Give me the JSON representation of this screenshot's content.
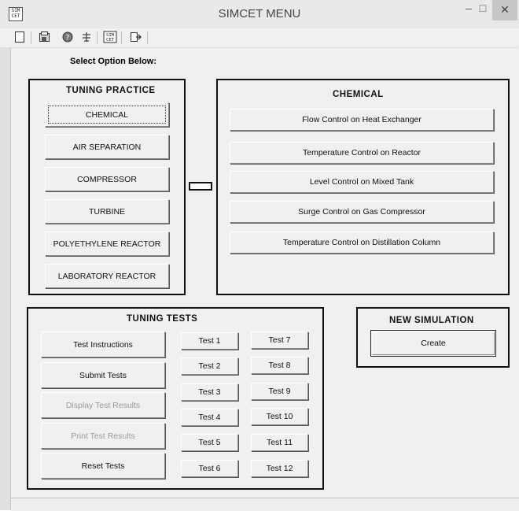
{
  "window": {
    "title": "SIMCET MENU",
    "app_icon_text": "SIM\nCET",
    "controls": {
      "minimize": "–",
      "maximize": "□",
      "close": "✕"
    }
  },
  "toolbar": {
    "icons": [
      "new-doc-icon",
      "open-folder-icon",
      "help-icon",
      "settings-icon",
      "simcet-icon",
      "exit-icon"
    ]
  },
  "main": {
    "select_label": "Select Option Below:",
    "tuning_practice": {
      "title": "TUNING PRACTICE",
      "buttons": [
        "CHEMICAL",
        "AIR SEPARATION",
        "COMPRESSOR",
        "TURBINE",
        "POLYETHYLENE REACTOR",
        "LABORATORY REACTOR"
      ]
    },
    "chemical": {
      "title": "CHEMICAL",
      "buttons": [
        "Flow Control on Heat Exchanger",
        "Temperature Control on Reactor",
        "Level Control on Mixed Tank",
        "Surge Control on Gas Compressor",
        "Temperature Control on Distillation Column"
      ]
    },
    "tuning_tests": {
      "title": "TUNING TESTS",
      "actions": [
        "Test Instructions",
        "Submit Tests",
        "Display Test Results",
        "Print Test Results",
        "Reset Tests"
      ],
      "tests_col1": [
        "Test 1",
        "Test 2",
        "Test 3",
        "Test 4",
        "Test 5",
        "Test 6"
      ],
      "tests_col2": [
        "Test 7",
        "Test 8",
        "Test 9",
        "Test 10",
        "Test 11",
        "Test 12"
      ]
    },
    "new_simulation": {
      "title": "NEW SIMULATION",
      "create": "Create"
    }
  }
}
